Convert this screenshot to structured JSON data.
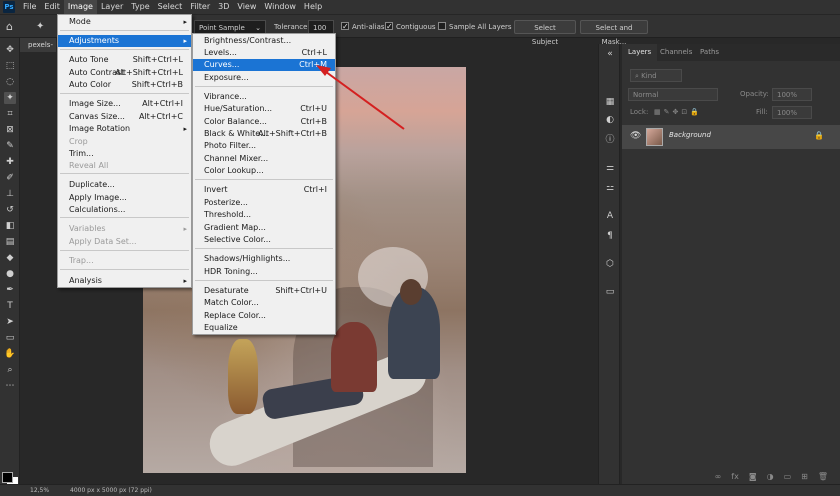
{
  "menubar": {
    "logo": "Ps",
    "items": [
      "File",
      "Edit",
      "Image",
      "Layer",
      "Type",
      "Select",
      "Filter",
      "3D",
      "View",
      "Window",
      "Help"
    ]
  },
  "options_bar": {
    "sample_size": "Point Sample",
    "tolerance_label": "Tolerance:",
    "tolerance_value": "100",
    "anti_alias": "Anti-alias",
    "contiguous": "Contiguous",
    "sample_all_layers": "Sample All Layers",
    "select_subject": "Select Subject",
    "select_and_mask": "Select and Mask..."
  },
  "document": {
    "tab_label": "pexels-"
  },
  "image_menu": {
    "items": [
      {
        "label": "Mode",
        "shortcut": "",
        "submenu": true,
        "disabled": false
      },
      {
        "label": "Adjustments",
        "shortcut": "",
        "submenu": true,
        "disabled": false
      },
      {
        "label": "Auto Tone",
        "shortcut": "Shift+Ctrl+L",
        "submenu": false,
        "disabled": false
      },
      {
        "label": "Auto Contrast",
        "shortcut": "Alt+Shift+Ctrl+L",
        "submenu": false,
        "disabled": false
      },
      {
        "label": "Auto Color",
        "shortcut": "Shift+Ctrl+B",
        "submenu": false,
        "disabled": false
      },
      {
        "label": "Image Size...",
        "shortcut": "Alt+Ctrl+I",
        "submenu": false,
        "disabled": false
      },
      {
        "label": "Canvas Size...",
        "shortcut": "Alt+Ctrl+C",
        "submenu": false,
        "disabled": false
      },
      {
        "label": "Image Rotation",
        "shortcut": "",
        "submenu": true,
        "disabled": false
      },
      {
        "label": "Crop",
        "shortcut": "",
        "submenu": false,
        "disabled": true
      },
      {
        "label": "Trim...",
        "shortcut": "",
        "submenu": false,
        "disabled": false
      },
      {
        "label": "Reveal All",
        "shortcut": "",
        "submenu": false,
        "disabled": true
      },
      {
        "label": "Duplicate...",
        "shortcut": "",
        "submenu": false,
        "disabled": false
      },
      {
        "label": "Apply Image...",
        "shortcut": "",
        "submenu": false,
        "disabled": false
      },
      {
        "label": "Calculations...",
        "shortcut": "",
        "submenu": false,
        "disabled": false
      },
      {
        "label": "Variables",
        "shortcut": "",
        "submenu": true,
        "disabled": true
      },
      {
        "label": "Apply Data Set...",
        "shortcut": "",
        "submenu": false,
        "disabled": true
      },
      {
        "label": "Trap...",
        "shortcut": "",
        "submenu": false,
        "disabled": true
      },
      {
        "label": "Analysis",
        "shortcut": "",
        "submenu": true,
        "disabled": false
      }
    ]
  },
  "adjustments_menu": {
    "items": [
      {
        "label": "Brightness/Contrast...",
        "shortcut": ""
      },
      {
        "label": "Levels...",
        "shortcut": "Ctrl+L"
      },
      {
        "label": "Curves...",
        "shortcut": "Ctrl+M"
      },
      {
        "label": "Exposure...",
        "shortcut": ""
      },
      {
        "label": "Vibrance...",
        "shortcut": ""
      },
      {
        "label": "Hue/Saturation...",
        "shortcut": "Ctrl+U"
      },
      {
        "label": "Color Balance...",
        "shortcut": "Ctrl+B"
      },
      {
        "label": "Black & White...",
        "shortcut": "Alt+Shift+Ctrl+B"
      },
      {
        "label": "Photo Filter...",
        "shortcut": ""
      },
      {
        "label": "Channel Mixer...",
        "shortcut": ""
      },
      {
        "label": "Color Lookup...",
        "shortcut": ""
      },
      {
        "label": "Invert",
        "shortcut": "Ctrl+I"
      },
      {
        "label": "Posterize...",
        "shortcut": ""
      },
      {
        "label": "Threshold...",
        "shortcut": ""
      },
      {
        "label": "Gradient Map...",
        "shortcut": ""
      },
      {
        "label": "Selective Color...",
        "shortcut": ""
      },
      {
        "label": "Shadows/Highlights...",
        "shortcut": ""
      },
      {
        "label": "HDR Toning...",
        "shortcut": ""
      },
      {
        "label": "Desaturate",
        "shortcut": "Shift+Ctrl+U"
      },
      {
        "label": "Match Color...",
        "shortcut": ""
      },
      {
        "label": "Replace Color...",
        "shortcut": ""
      },
      {
        "label": "Equalize",
        "shortcut": ""
      }
    ]
  },
  "panel": {
    "tabs": [
      "Layers",
      "Channels",
      "Paths"
    ],
    "filter_kind": "Kind",
    "blend_mode": "Normal",
    "opacity_label": "Opacity:",
    "opacity_value": "100%",
    "lock_label": "Lock:",
    "fill_label": "Fill:",
    "fill_value": "100%",
    "layer_name": "Background"
  },
  "status": {
    "zoom": "12,5%",
    "info": "4000 px x 5000 px (72 ppi)"
  },
  "colors": {
    "highlight": "#1b74d4",
    "annotation_arrow": "#d42020"
  }
}
